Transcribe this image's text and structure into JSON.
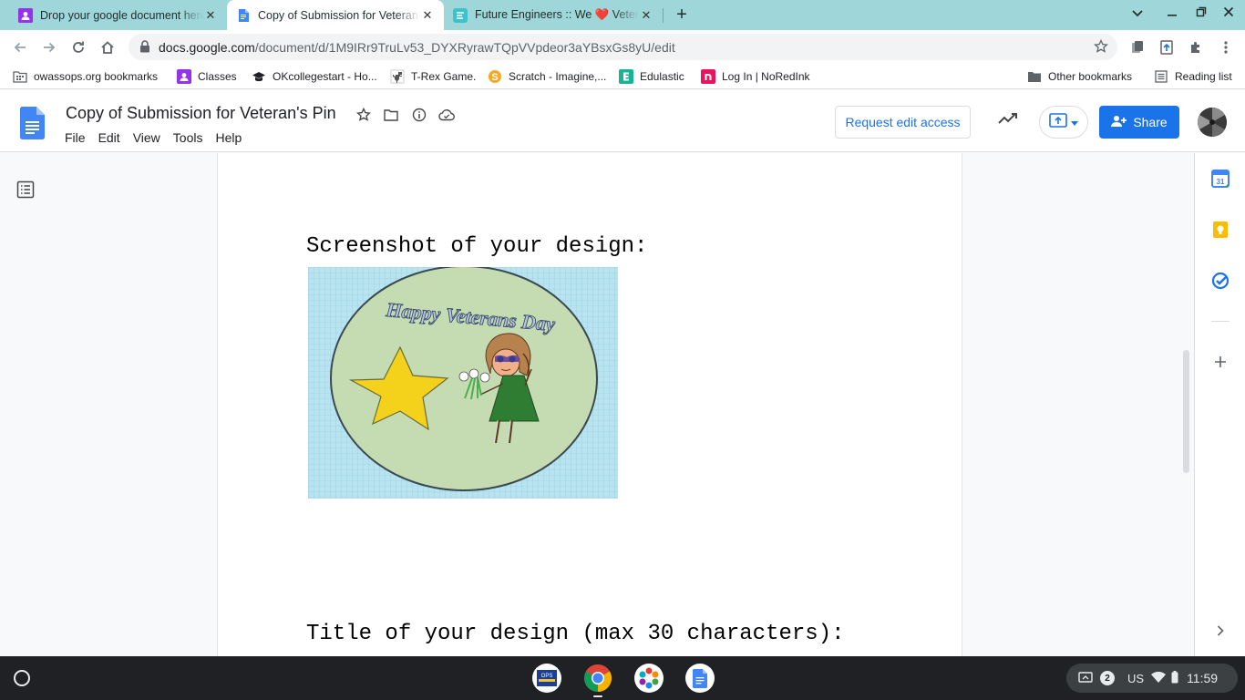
{
  "tabs": [
    {
      "title": "Drop your google document here",
      "favicon": "classroom-icon",
      "active": false
    },
    {
      "title": "Copy of Submission for Veteran's Pin",
      "favicon": "docs-icon",
      "active": true
    },
    {
      "title": "Future Engineers :: We ❤️ Veterans",
      "favicon": "future-engineers-icon",
      "active": false
    }
  ],
  "new_tab_label": "+",
  "address": {
    "host": "docs.google.com",
    "path": "/document/d/1M9IRr9TruLv53_DYXRyrawTQpVVpdeor3aYBsxGs8yU/edit"
  },
  "bookmarks": [
    {
      "label": "owassops.org bookmarks",
      "icon": "folder-icon"
    },
    {
      "label": "Classes",
      "icon": "classroom-icon"
    },
    {
      "label": "OKcollegestart - Ho...",
      "icon": "graduation-cap-icon"
    },
    {
      "label": "T-Rex Game.",
      "icon": "trex-icon"
    },
    {
      "label": "Scratch - Imagine,...",
      "icon": "scratch-icon"
    },
    {
      "label": "Edulastic",
      "icon": "edulastic-icon"
    },
    {
      "label": "Log In | NoRedInk",
      "icon": "noredink-icon"
    }
  ],
  "other_bookmarks": "Other bookmarks",
  "reading_list": "Reading list",
  "doc": {
    "title": "Copy of Submission for Veteran's Pin",
    "menu": [
      "File",
      "Edit",
      "View",
      "Tools",
      "Help"
    ],
    "request_edit": "Request edit access",
    "share": "Share",
    "body": {
      "screenshot_label": "Screenshot of your design:",
      "image_text": "Happy Veterans Day",
      "title_label": "Title of your design (max 30 characters):"
    }
  },
  "shelf": {
    "locale": "US",
    "notifications": "2",
    "time": "11:59"
  },
  "colors": {
    "tabstrip": "#9fd6d9",
    "share_blue": "#1a73e8",
    "docs_blue": "#4285f4",
    "shelf": "#202124"
  }
}
